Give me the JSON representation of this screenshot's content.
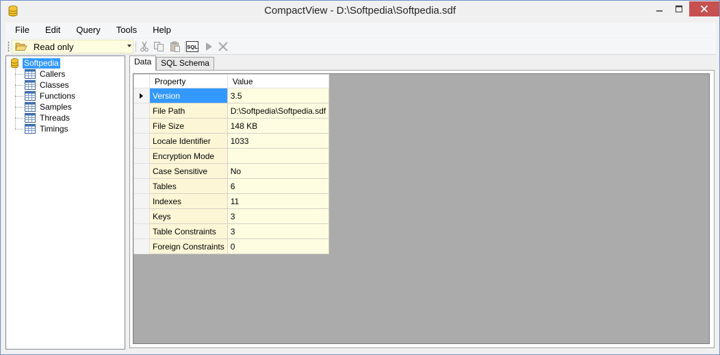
{
  "window": {
    "title": "CompactView - D:\\Softpedia\\Softpedia.sdf",
    "icon": "database-icon",
    "controls": [
      "minimize-icon",
      "maximize-icon",
      "close-icon"
    ]
  },
  "menu": [
    "File",
    "Edit",
    "Query",
    "Tools",
    "Help"
  ],
  "toolbar": {
    "mode_combo": "Read only",
    "buttons": [
      "cut-icon",
      "copy-icon",
      "paste-icon",
      "sql-icon",
      "run-icon",
      "cancel-icon"
    ],
    "sql_label": "SQL"
  },
  "tree": {
    "root": "Softpedia",
    "children": [
      "Callers",
      "Classes",
      "Functions",
      "Samples",
      "Threads",
      "Timings"
    ]
  },
  "tabs": [
    "Data",
    "SQL Schema"
  ],
  "grid": {
    "columns": [
      "Property",
      "Value"
    ],
    "rows": [
      {
        "property": "Version",
        "value": "3.5"
      },
      {
        "property": "File Path",
        "value": "D:\\Softpedia\\Softpedia.sdf"
      },
      {
        "property": "File Size",
        "value": "148 KB"
      },
      {
        "property": "Locale Identifier",
        "value": "1033"
      },
      {
        "property": "Encryption Mode",
        "value": ""
      },
      {
        "property": "Case Sensitive",
        "value": "No"
      },
      {
        "property": "Tables",
        "value": "6"
      },
      {
        "property": "Indexes",
        "value": "11"
      },
      {
        "property": "Keys",
        "value": "3"
      },
      {
        "property": "Table Constraints",
        "value": "3"
      },
      {
        "property": "Foreign Constraints",
        "value": "0"
      }
    ],
    "selected_row": 0
  },
  "colors": {
    "selection": "#3399ff",
    "close_button": "#c75050",
    "grid_background": "#ababab",
    "property_cell": "#fdf6d6",
    "value_cell": "#fffde1"
  }
}
